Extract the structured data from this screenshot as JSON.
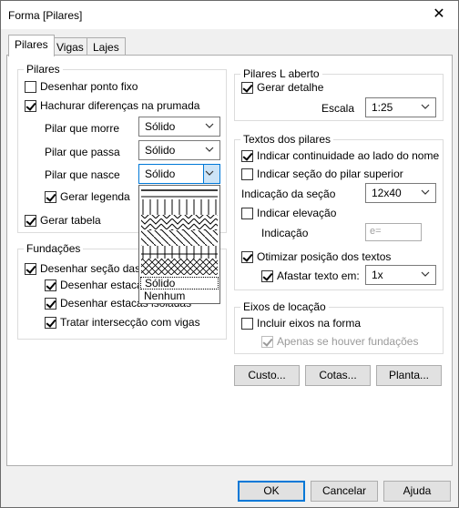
{
  "window": {
    "title": "Forma [Pilares]",
    "close_glyph": "✕"
  },
  "tabs": [
    "Pilares",
    "Vigas",
    "Lajes"
  ],
  "pilares": {
    "group_label": "Pilares",
    "desenhar_ponto_fixo": "Desenhar ponto fixo",
    "hachurar": "Hachurar diferenças na prumada",
    "pilar_que_morre": {
      "label": "Pilar que morre",
      "value": "Sólido"
    },
    "pilar_que_passa": {
      "label": "Pilar que passa",
      "value": "Sólido"
    },
    "pilar_que_nasce": {
      "label": "Pilar que nasce",
      "value": "Sólido"
    },
    "gerar_legenda": "Gerar legenda",
    "gerar_tabela": "Gerar tabela"
  },
  "dropdown": {
    "options": [
      "Sólido",
      "Nenhum"
    ],
    "selected": "Sólido"
  },
  "fundacoes": {
    "group_label": "Fundações",
    "desenhar_secao": "Desenhar seção das fu",
    "estacas": "Desenhar estacas",
    "estacas_isoladas": "Desenhar estacas isoladas",
    "intersec": "Tratar intersecção com vigas"
  },
  "pilares_l": {
    "group_label": "Pilares L aberto",
    "gerar_detalhe": "Gerar detalhe",
    "escala_label": "Escala",
    "escala_value": "1:25"
  },
  "textos": {
    "group_label": "Textos dos pilares",
    "indicar_continuidade": "Indicar continuidade ao lado do nome",
    "indicar_secao_superior": "Indicar seção do pilar superior",
    "indicacao_secao_label": "Indicação da seção",
    "indicacao_secao_value": "12x40",
    "indicar_elevacao": "Indicar elevação",
    "indicacao_label": "Indicação",
    "indicacao_placeholder": "e=",
    "otimizar": "Otimizar posição dos textos",
    "afastar": "Afastar texto em:",
    "afastar_value": "1x"
  },
  "eixos": {
    "group_label": "Eixos de locação",
    "incluir": "Incluir eixos na forma",
    "apenas": "Apenas se houver fundações"
  },
  "action_buttons": {
    "custo": "Custo...",
    "cotas": "Cotas...",
    "planta": "Planta..."
  },
  "dialog_buttons": {
    "ok": "OK",
    "cancelar": "Cancelar",
    "ajuda": "Ajuda"
  }
}
